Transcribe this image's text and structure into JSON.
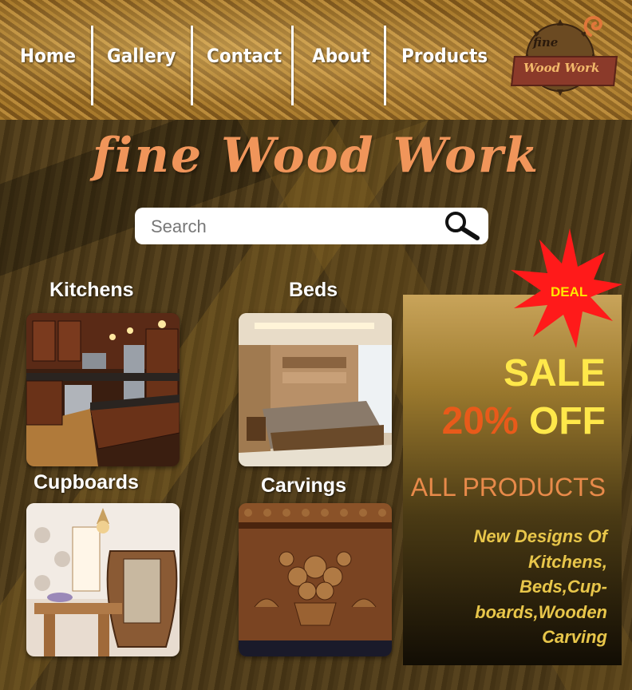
{
  "nav": {
    "items": [
      {
        "label": "Home"
      },
      {
        "label": "Gallery"
      },
      {
        "label": "Contact"
      },
      {
        "label": "About"
      },
      {
        "label": "Products"
      }
    ]
  },
  "logo": {
    "line1": "fine",
    "line2": "Wood Work"
  },
  "site_title": "fine Wood Work",
  "search": {
    "placeholder": "Search",
    "value": "",
    "icon": "magnifier-icon"
  },
  "categories": [
    {
      "label": "Kitchens"
    },
    {
      "label": "Beds"
    },
    {
      "label": "Cupboards"
    },
    {
      "label": "Carvings"
    }
  ],
  "deal": {
    "badge": "DEAL",
    "sale": "SALE",
    "percent": "20%",
    "off": "OFF",
    "all_products": "ALL PRODUCTS",
    "description_lines": [
      "New Designs Of",
      "Kitchens,",
      "Beds,Cup-",
      "boards,Wooden",
      "Carving"
    ]
  },
  "colors": {
    "title": "#f0955a",
    "sale": "#ffe84a",
    "percent": "#e85a1a",
    "all_products": "#e88a4a",
    "description": "#e8c64a",
    "badge_burst": "#ff1a1a",
    "badge_text": "#ffe600"
  }
}
